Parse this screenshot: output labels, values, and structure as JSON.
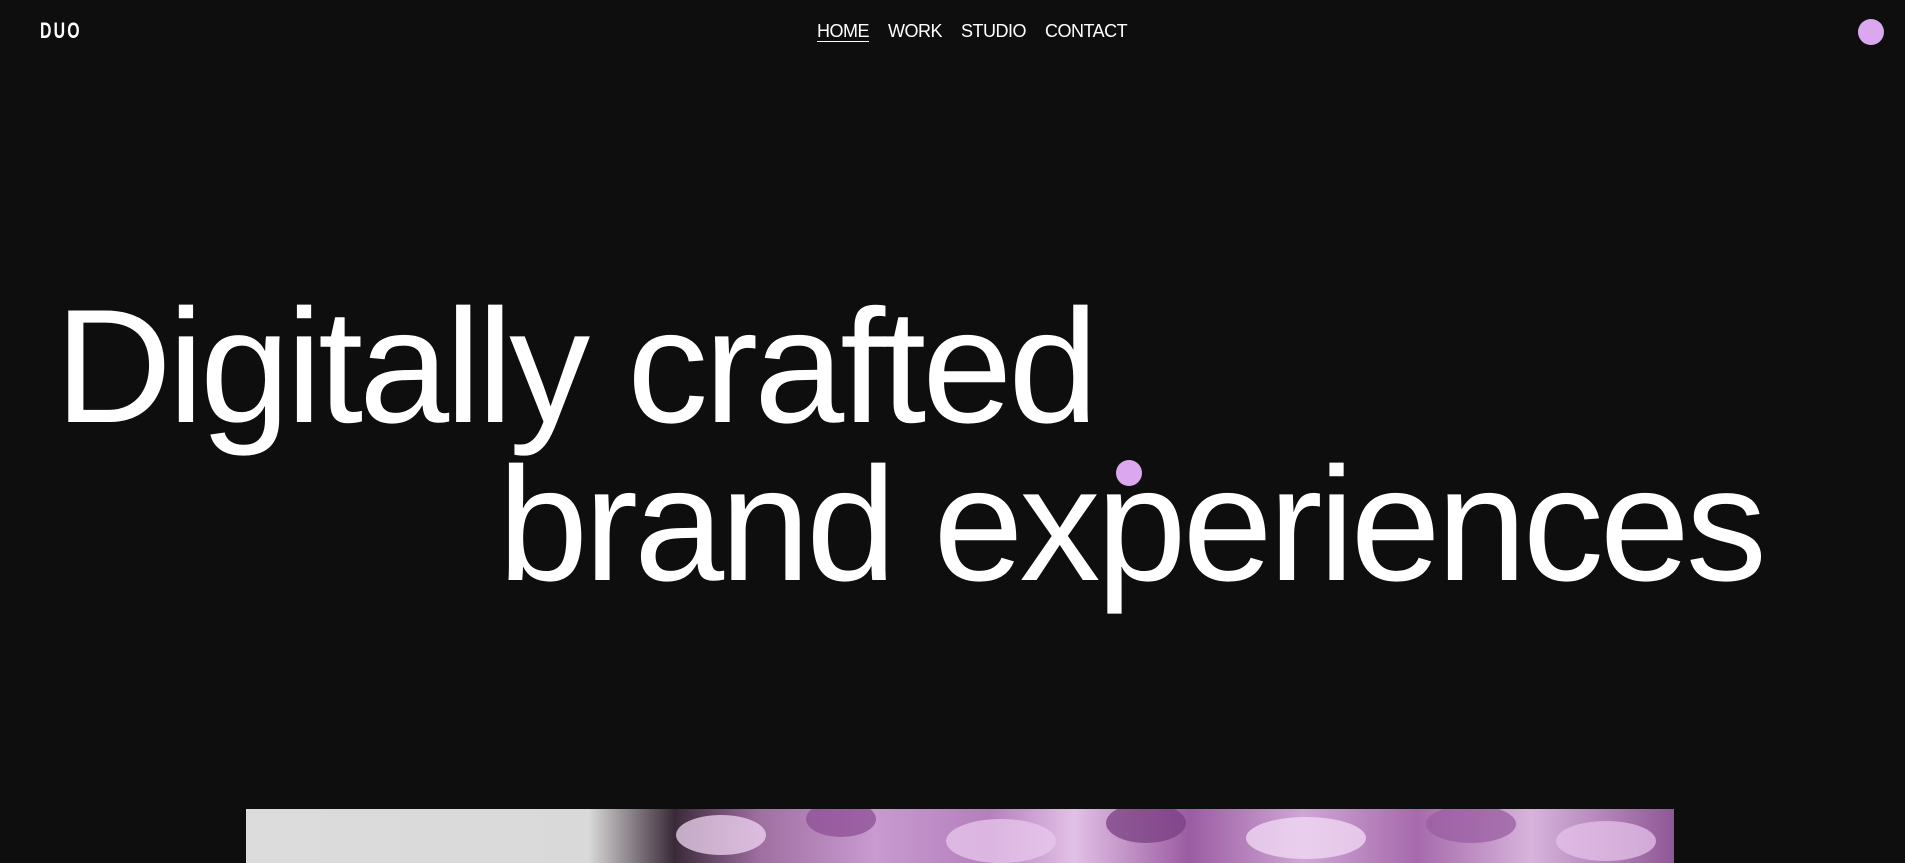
{
  "brand": {
    "logo_text": "DUO"
  },
  "nav": {
    "items": [
      {
        "label": "HOME",
        "active": true
      },
      {
        "label": "WORK",
        "active": false
      },
      {
        "label": "STUDIO",
        "active": false
      },
      {
        "label": "CONTACT",
        "active": false
      }
    ]
  },
  "hero": {
    "line1": "Digitally crafted",
    "line2": "brand experiences"
  },
  "colors": {
    "background": "#0f0e0f",
    "accent": "#dba7ee",
    "text": "#ffffff"
  },
  "icons": {
    "menu": "menu-dot-icon",
    "cursor": "cursor-dot-icon"
  }
}
